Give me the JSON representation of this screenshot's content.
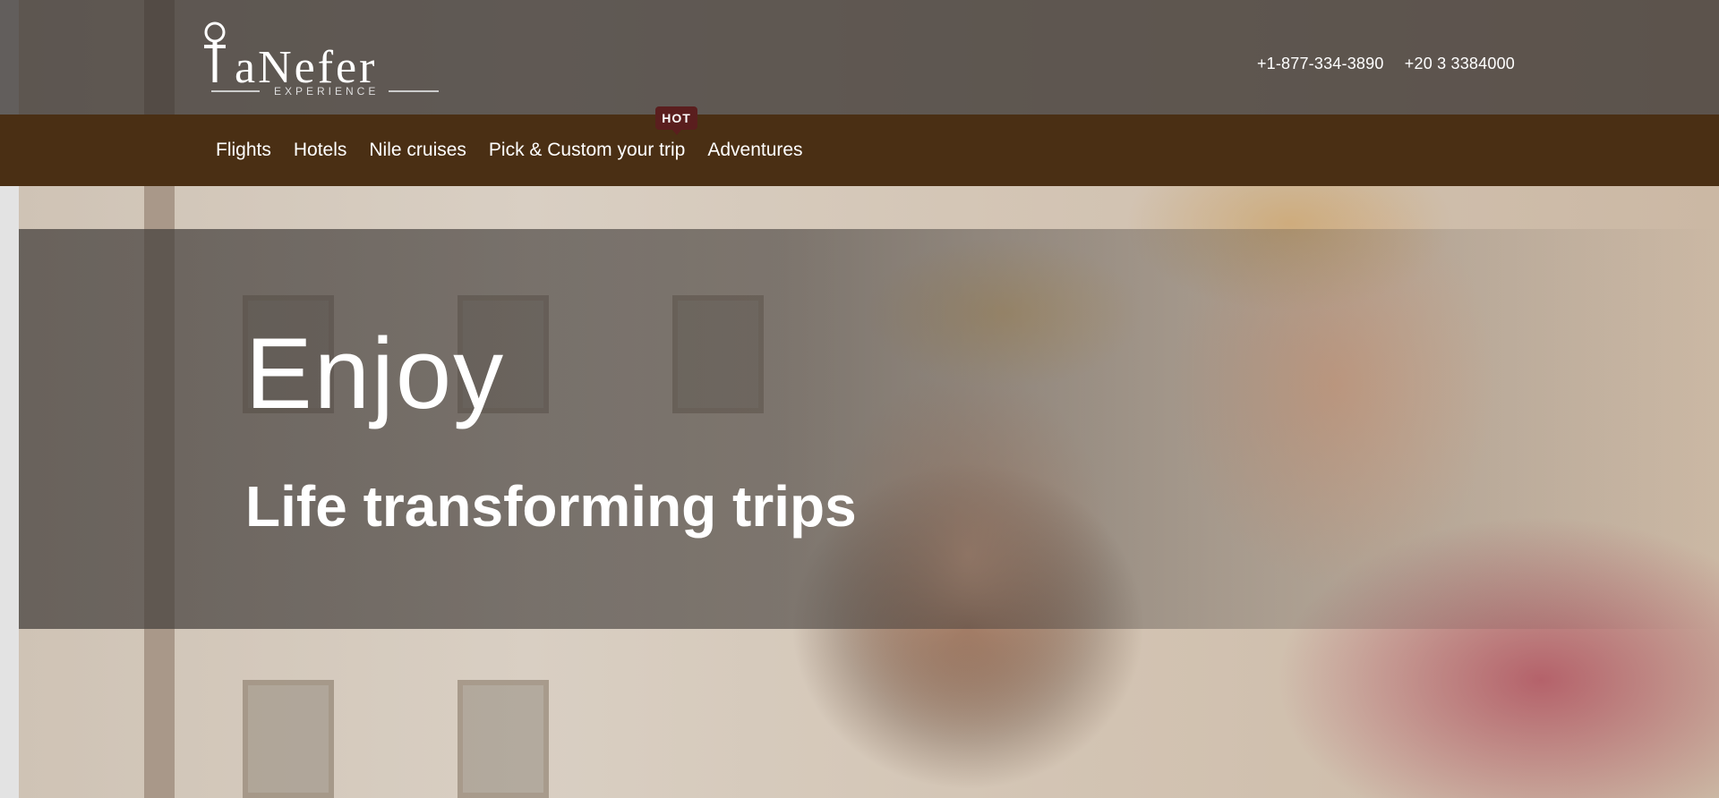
{
  "brand": {
    "logo_text": "TaNefer",
    "logo_sub": "EXPERIENCE"
  },
  "header": {
    "phones": [
      "+1-877-334-3890",
      "+20 3 3384000"
    ]
  },
  "nav": {
    "items": [
      "Flights",
      "Hotels",
      "Nile cruises",
      "Pick & Custom your trip",
      "Adventures"
    ],
    "badge": "HOT"
  },
  "hero": {
    "headline": "Enjoy",
    "subline": "Life transforming trips"
  },
  "colors": {
    "nav_bg": "#4a2f14",
    "badge_bg": "#5a1e1e",
    "header_overlay": "#37322f"
  }
}
